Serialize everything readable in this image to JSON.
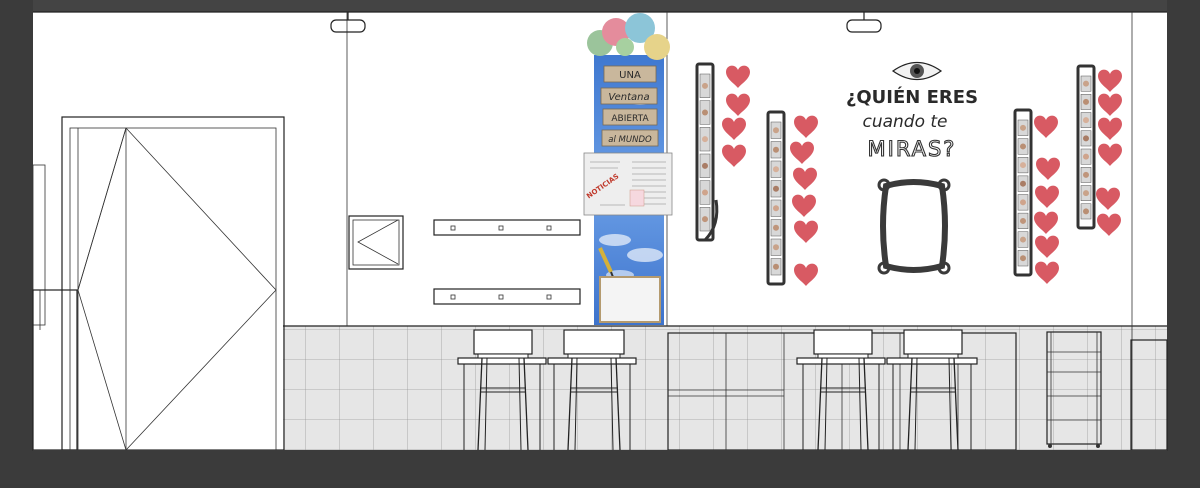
{
  "wall_text": {
    "heading_line1": "¿QUIÉN ERES",
    "heading_line2": "cuando te",
    "heading_line3": "MIRAS?"
  },
  "banner": {
    "sign1": "UNA",
    "sign2": "Ventana",
    "sign3": "ABIERTA",
    "sign4": "al MUNDO",
    "newspaper_stamp": "NOTICIAS"
  },
  "colors": {
    "frame": "#3b3b3b",
    "wall": "#ffffff",
    "tile": "#e4e4e4",
    "banner_blue": "#4f86d8",
    "heart": "#d85a63",
    "sign_wood": "#c9b79c"
  },
  "icons": [
    "eye-icon",
    "heart-icon",
    "balloon-icon",
    "mirror-frame-icon",
    "pencil-icon"
  ]
}
